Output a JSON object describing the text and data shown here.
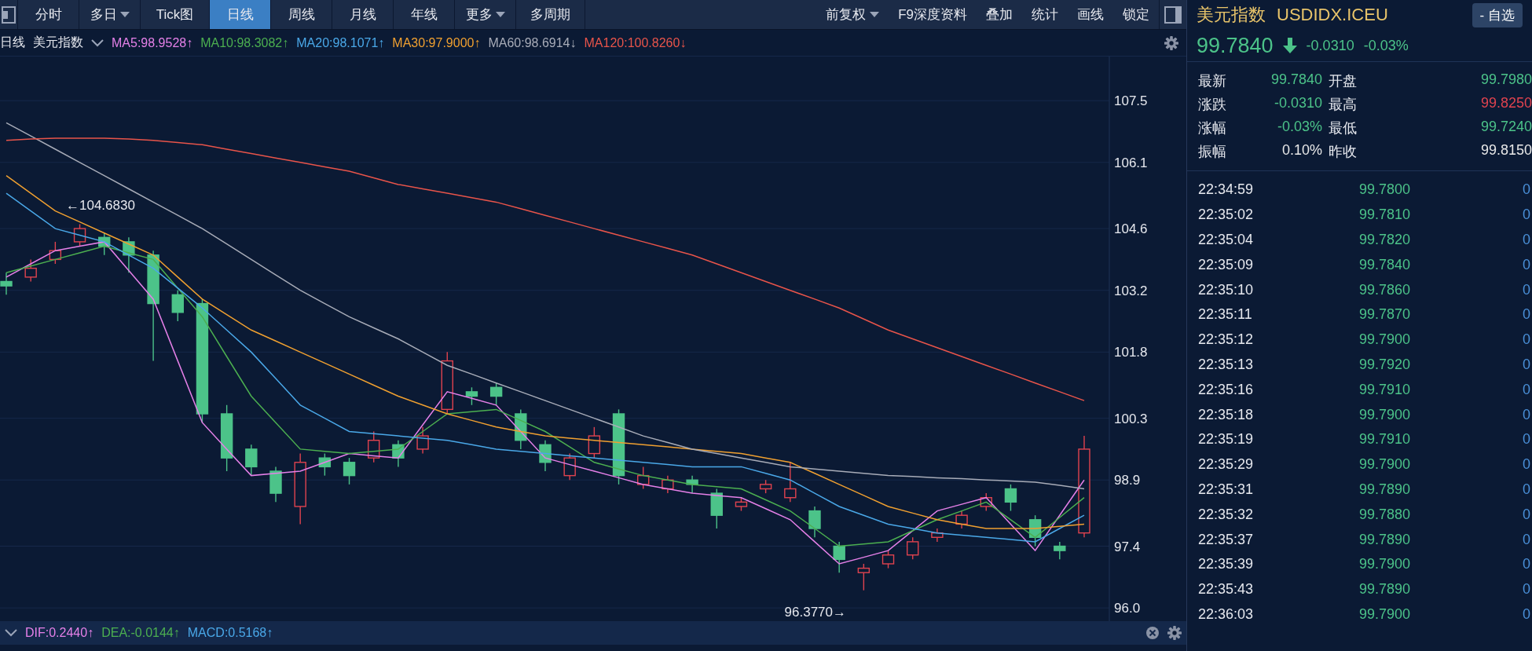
{
  "toolbar": {
    "tabs": [
      {
        "label": "分时",
        "selected": false,
        "dropdown": false
      },
      {
        "label": "多日",
        "selected": false,
        "dropdown": true
      },
      {
        "label": "Tick图",
        "selected": false,
        "dropdown": false
      },
      {
        "label": "日线",
        "selected": true,
        "dropdown": false
      },
      {
        "label": "周线",
        "selected": false,
        "dropdown": false
      },
      {
        "label": "月线",
        "selected": false,
        "dropdown": false
      },
      {
        "label": "年线",
        "selected": false,
        "dropdown": false
      },
      {
        "label": "更多",
        "selected": false,
        "dropdown": true
      },
      {
        "label": "多周期",
        "selected": false,
        "dropdown": false
      }
    ],
    "actions": [
      {
        "label": "前复权",
        "dropdown": true
      },
      {
        "label": "F9深度资料",
        "dropdown": false
      },
      {
        "label": "叠加",
        "dropdown": false
      },
      {
        "label": "统计",
        "dropdown": false
      },
      {
        "label": "画线",
        "dropdown": false
      },
      {
        "label": "锁定",
        "dropdown": false
      }
    ]
  },
  "indicator_bar": {
    "period": "日线",
    "name": "美元指数",
    "items": [
      {
        "value": ":98.9528",
        "arrow": "↑"
      },
      {
        "value": ":98.3082",
        "arrow": "↑"
      },
      {
        "value": ":98.1071",
        "arrow": "↑"
      },
      {
        "value": ":97.9000",
        "arrow": "↑"
      },
      {
        "value": ":98.6914",
        "arrow": "↓"
      },
      {
        "value": ":100.8260",
        "arrow": "↓"
      }
    ]
  },
  "chart": {
    "high_marker": "←104.6830",
    "low_marker": "96.3770→",
    "chart_data": {
      "type": "candlestick",
      "ylim": [
        95.7,
        108.5
      ],
      "grid": true,
      "yticks": [
        {
          "value": 107.5,
          "label": "107.5"
        },
        {
          "value": 106.1,
          "label": "106.1"
        },
        {
          "value": 104.6,
          "label": "104.6"
        },
        {
          "value": 103.2,
          "label": "103.2"
        },
        {
          "value": 101.8,
          "label": "101.8"
        },
        {
          "value": 100.3,
          "label": "100.3"
        },
        {
          "value": 98.9,
          "label": "98.9"
        },
        {
          "value": 97.4,
          "label": "97.4"
        },
        {
          "value": 96.0,
          "label": "96.0"
        }
      ],
      "categories": [
        null,
        null,
        null,
        null,
        null,
        null,
        null,
        null,
        null,
        null,
        null,
        null,
        null,
        null,
        null,
        null,
        null,
        null,
        null,
        null,
        null,
        null,
        null,
        null,
        null,
        null,
        null,
        null,
        null,
        null,
        null,
        null,
        null,
        null,
        null,
        null,
        null,
        null,
        null,
        null,
        null,
        null,
        null,
        null,
        null
      ],
      "ohlc": [
        [
          103.4,
          103.6,
          103.1,
          103.3
        ],
        [
          103.5,
          103.9,
          103.4,
          103.7
        ],
        [
          103.9,
          104.3,
          103.8,
          104.1
        ],
        [
          104.3,
          104.7,
          104.2,
          104.6
        ],
        [
          104.4,
          104.5,
          104.0,
          104.2
        ],
        [
          104.3,
          104.4,
          103.6,
          104.0
        ],
        [
          104.0,
          104.1,
          101.6,
          102.9
        ],
        [
          103.1,
          103.2,
          102.5,
          102.7
        ],
        [
          102.9,
          103.0,
          100.2,
          100.4
        ],
        [
          100.4,
          100.6,
          99.1,
          99.4
        ],
        [
          99.6,
          99.7,
          99.0,
          99.2
        ],
        [
          99.1,
          99.2,
          98.4,
          98.6
        ],
        [
          98.3,
          99.5,
          97.9,
          99.3
        ],
        [
          99.4,
          99.5,
          99.0,
          99.2
        ],
        [
          99.3,
          99.4,
          98.8,
          99.0
        ],
        [
          99.4,
          100.0,
          99.3,
          99.8
        ],
        [
          99.7,
          99.8,
          99.2,
          99.4
        ],
        [
          99.6,
          100.1,
          99.5,
          99.9
        ],
        [
          100.5,
          101.8,
          100.4,
          101.6
        ],
        [
          100.9,
          101.0,
          100.6,
          100.8
        ],
        [
          101.0,
          101.1,
          100.6,
          100.8
        ],
        [
          100.4,
          100.5,
          99.6,
          99.8
        ],
        [
          99.7,
          99.8,
          99.1,
          99.3
        ],
        [
          99.0,
          99.5,
          98.9,
          99.4
        ],
        [
          99.5,
          100.1,
          99.4,
          99.9
        ],
        [
          100.4,
          100.5,
          98.8,
          99.0
        ],
        [
          98.8,
          99.2,
          98.7,
          99.0
        ],
        [
          98.7,
          99.0,
          98.6,
          98.9
        ],
        [
          98.9,
          99.0,
          98.6,
          98.8
        ],
        [
          98.6,
          98.7,
          97.8,
          98.1
        ],
        [
          98.3,
          98.5,
          98.2,
          98.4
        ],
        [
          98.7,
          98.9,
          98.6,
          98.8
        ],
        [
          98.5,
          99.3,
          98.4,
          98.7
        ],
        [
          98.2,
          98.3,
          97.6,
          97.8
        ],
        [
          97.4,
          97.5,
          96.8,
          97.1
        ],
        [
          96.8,
          97.0,
          96.4,
          96.9
        ],
        [
          97.0,
          97.3,
          96.9,
          97.2
        ],
        [
          97.2,
          97.6,
          97.1,
          97.5
        ],
        [
          97.6,
          97.8,
          97.5,
          97.7
        ],
        [
          97.9,
          98.2,
          97.8,
          98.1
        ],
        [
          98.3,
          98.6,
          98.2,
          98.5
        ],
        [
          98.7,
          98.8,
          98.2,
          98.4
        ],
        [
          98.0,
          98.1,
          97.4,
          97.6
        ],
        [
          97.4,
          97.5,
          97.1,
          97.3
        ],
        [
          97.7,
          99.9,
          97.6,
          99.6
        ]
      ],
      "series": [
        {
          "name": "MA5",
          "type": "line",
          "color": "#e580e8",
          "values": [
            103.5,
            103.8,
            104.1,
            104.2,
            104.3,
            103.65,
            103.0,
            101.6,
            100.2,
            99.6,
            99.0,
            99.05,
            99.1,
            99.3,
            99.5,
            99.45,
            99.4,
            100.15,
            100.9,
            100.75,
            100.6,
            100.0,
            99.4,
            99.25,
            99.1,
            98.95,
            98.8,
            98.7,
            98.6,
            98.55,
            98.5,
            98.25,
            98.0,
            97.5,
            97.0,
            97.15,
            97.3,
            97.75,
            98.2,
            98.35,
            98.5,
            97.9,
            97.3,
            98.1,
            98.9
          ]
        },
        {
          "name": "MA10",
          "type": "line",
          "color": "#4caf50",
          "values": [
            103.6,
            103.75,
            103.9,
            104.05,
            104.2,
            104.05,
            103.9,
            103.25,
            102.6,
            101.7,
            100.8,
            100.2,
            99.6,
            99.55,
            99.5,
            99.55,
            99.6,
            100.0,
            100.4,
            100.45,
            100.5,
            100.25,
            100.0,
            99.65,
            99.3,
            99.15,
            99.0,
            98.9,
            98.8,
            98.75,
            98.7,
            98.45,
            98.2,
            97.8,
            97.4,
            97.45,
            97.5,
            97.75,
            98.0,
            98.2,
            98.4,
            98.0,
            97.6,
            98.05,
            98.5
          ]
        },
        {
          "name": "MA20",
          "type": "line",
          "color": "#4aa8e8",
          "values": [
            105.4,
            105.0,
            104.6,
            104.45,
            104.3,
            104.0,
            103.7,
            103.25,
            102.8,
            102.3,
            101.8,
            101.2,
            100.6,
            100.3,
            100.0,
            99.95,
            99.9,
            99.85,
            99.8,
            99.7,
            99.6,
            99.55,
            99.5,
            99.45,
            99.4,
            99.35,
            99.3,
            99.25,
            99.2,
            99.2,
            99.2,
            99.05,
            98.9,
            98.6,
            98.3,
            98.1,
            97.9,
            97.8,
            97.7,
            97.65,
            97.6,
            97.55,
            97.5,
            97.8,
            98.1
          ]
        },
        {
          "name": "MA30",
          "type": "line",
          "color": "#f0a030",
          "values": [
            105.8,
            105.4,
            105.0,
            104.75,
            104.5,
            104.25,
            104.0,
            103.5,
            103.0,
            102.65,
            102.3,
            102.05,
            101.8,
            101.55,
            101.3,
            101.05,
            100.8,
            100.6,
            100.4,
            100.25,
            100.1,
            100.0,
            99.9,
            99.85,
            99.8,
            99.75,
            99.7,
            99.65,
            99.6,
            99.55,
            99.5,
            99.4,
            99.3,
            99.05,
            98.8,
            98.55,
            98.3,
            98.15,
            98.0,
            97.9,
            97.8,
            97.8,
            97.8,
            97.85,
            97.9
          ]
        },
        {
          "name": "MA60",
          "type": "line",
          "color": "#a8acb8",
          "values": [
            107.0,
            106.7,
            106.4,
            106.1,
            105.8,
            105.5,
            105.2,
            104.9,
            104.6,
            104.25,
            103.9,
            103.55,
            103.2,
            102.9,
            102.6,
            102.35,
            102.1,
            101.8,
            101.5,
            101.3,
            101.1,
            100.9,
            100.7,
            100.5,
            100.3,
            100.1,
            99.9,
            99.75,
            99.6,
            99.5,
            99.4,
            99.3,
            99.2,
            99.15,
            99.1,
            99.05,
            99.0,
            98.98,
            98.95,
            98.93,
            98.9,
            98.88,
            98.85,
            98.78,
            98.7
          ]
        },
        {
          "name": "MA120",
          "type": "line",
          "color": "#e8544a",
          "values": [
            106.6,
            106.63,
            106.65,
            106.65,
            106.65,
            106.63,
            106.6,
            106.55,
            106.5,
            106.4,
            106.3,
            106.2,
            106.1,
            106.0,
            105.9,
            105.75,
            105.6,
            105.5,
            105.4,
            105.3,
            105.2,
            105.05,
            104.9,
            104.75,
            104.6,
            104.45,
            104.3,
            104.15,
            104.0,
            103.8,
            103.6,
            103.4,
            103.2,
            103.0,
            102.8,
            102.55,
            102.3,
            102.1,
            101.9,
            101.7,
            101.5,
            101.3,
            101.1,
            100.9,
            100.7
          ]
        }
      ]
    }
  },
  "macd_bar": {
    "items": [
      {
        "text": "DIF:0.2440",
        "arrow": "↑",
        "color": "#e580e8"
      },
      {
        "text": "DEA:-0.0144",
        "arrow": "↑",
        "color": "#4caf50"
      },
      {
        "text": "MACD:0.5168",
        "arrow": "↑",
        "color": "#4aa8e8"
      }
    ]
  },
  "quote_panel": {
    "name": "美元指数",
    "code": "USDIDX.ICEU",
    "watchlist_button": "- 自选",
    "price": "99.7840",
    "falling": true,
    "change": "-0.0310",
    "change_pct": "-0.03%",
    "stats": [
      {
        "label": "最新",
        "value": "99.7840",
        "color": "#4cc389"
      },
      {
        "label": "开盘",
        "value": "99.7980",
        "color": "#4cc389"
      },
      {
        "label": "涨跌",
        "value": "-0.0310",
        "color": "#4cc389"
      },
      {
        "label": "最高",
        "value": "99.8250",
        "color": "#e0434f"
      },
      {
        "label": "涨幅",
        "value": "-0.03%",
        "color": "#4cc389"
      },
      {
        "label": "最低",
        "value": "99.7240",
        "color": "#4cc389"
      },
      {
        "label": "振幅",
        "value": "0.10%",
        "color": "#e8e8e8"
      },
      {
        "label": "昨收",
        "value": "99.8150",
        "color": "#e8e8e8"
      }
    ],
    "ticks": [
      {
        "time": "22:34:59",
        "price": "99.7800",
        "volume": "0"
      },
      {
        "time": "22:35:02",
        "price": "99.7810",
        "volume": "0"
      },
      {
        "time": "22:35:04",
        "price": "99.7820",
        "volume": "0"
      },
      {
        "time": "22:35:09",
        "price": "99.7840",
        "volume": "0"
      },
      {
        "time": "22:35:10",
        "price": "99.7860",
        "volume": "0"
      },
      {
        "time": "22:35:11",
        "price": "99.7870",
        "volume": "0"
      },
      {
        "time": "22:35:12",
        "price": "99.7900",
        "volume": "0"
      },
      {
        "time": "22:35:13",
        "price": "99.7920",
        "volume": "0"
      },
      {
        "time": "22:35:16",
        "price": "99.7910",
        "volume": "0"
      },
      {
        "time": "22:35:18",
        "price": "99.7900",
        "volume": "0"
      },
      {
        "time": "22:35:19",
        "price": "99.7910",
        "volume": "0"
      },
      {
        "time": "22:35:29",
        "price": "99.7900",
        "volume": "0"
      },
      {
        "time": "22:35:31",
        "price": "99.7890",
        "volume": "0"
      },
      {
        "time": "22:35:32",
        "price": "99.7880",
        "volume": "0"
      },
      {
        "time": "22:35:37",
        "price": "99.7890",
        "volume": "0"
      },
      {
        "time": "22:35:39",
        "price": "99.7900",
        "volume": "0"
      },
      {
        "time": "22:35:43",
        "price": "99.7890",
        "volume": "0"
      },
      {
        "time": "22:36:03",
        "price": "99.7900",
        "volume": "0"
      }
    ]
  }
}
